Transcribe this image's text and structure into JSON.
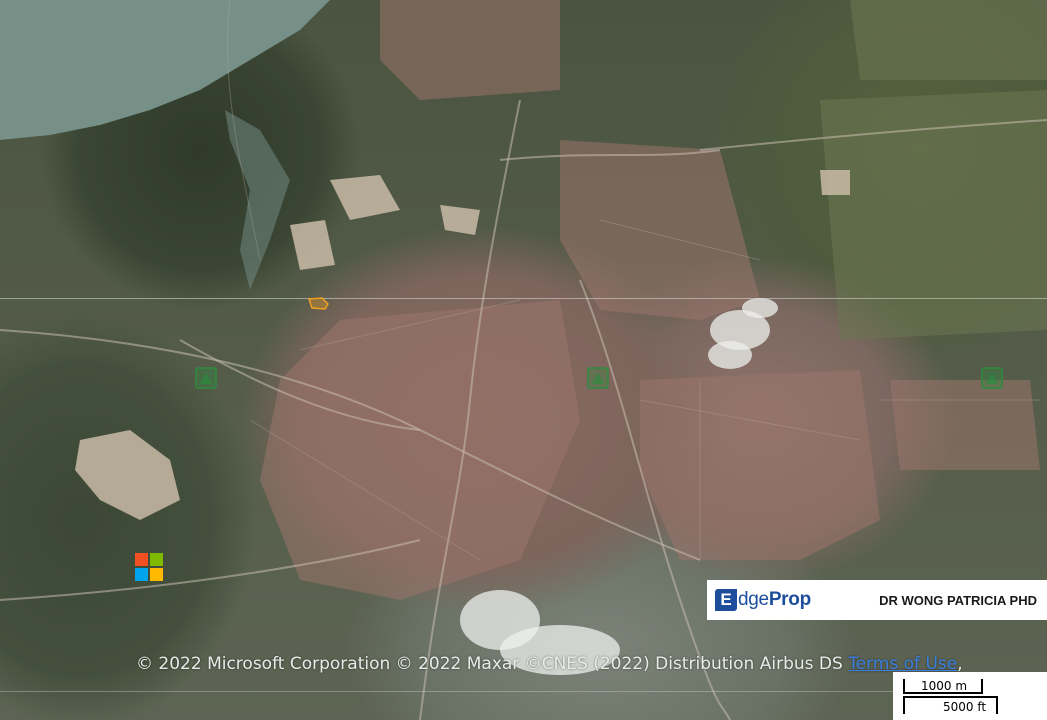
{
  "copyright": {
    "text": "© 2022 Microsoft Corporation © 2022 Maxar ©CNES (2022) Distribution Airbus DS ",
    "terms_link": "Terms of Use",
    "terms_suffix": ","
  },
  "banner": {
    "logo_prefix": "E",
    "logo_mid": "dge",
    "logo_suffix": "Prop",
    "agent_name": "DR WONG PATRICIA PHD",
    "brand_color": "#1d4e9e"
  },
  "scale": {
    "metric_label": "1000 m",
    "imperial_label": "5000 ft"
  },
  "icons": {
    "microsoft_logo": "microsoft-logo",
    "poi_marker": "green-poi-marker",
    "property_marker": "orange-property-outline"
  },
  "colors": {
    "ms_red": "#f25022",
    "ms_green": "#7fba00",
    "ms_blue": "#00a4ef",
    "ms_yellow": "#ffb900",
    "property_outline": "#f0a020",
    "poi_green": "#2e8b3e"
  }
}
